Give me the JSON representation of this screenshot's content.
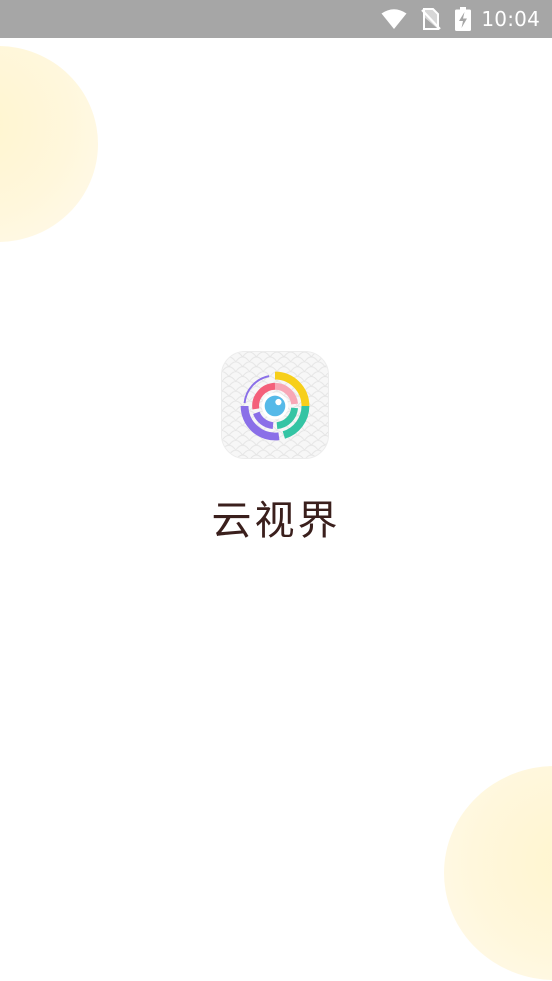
{
  "status_bar": {
    "time": "10:04",
    "icons": [
      "wifi-icon",
      "no-sim-icon",
      "battery-charging-icon"
    ]
  },
  "splash": {
    "app_name": "云视界",
    "logo": "yunshijie-logo-icon"
  },
  "colors": {
    "status_bar_bg": "#a6a6a6",
    "background": "#ffffff",
    "blob": "#fff6d6",
    "app_name_text": "#3a1f1c",
    "ring_yellow": "#f7cf1a",
    "ring_green": "#34c4a4",
    "ring_purple": "#8a6fe8",
    "ring_pink": "#f4607a",
    "eye_blue": "#55b9e8"
  }
}
